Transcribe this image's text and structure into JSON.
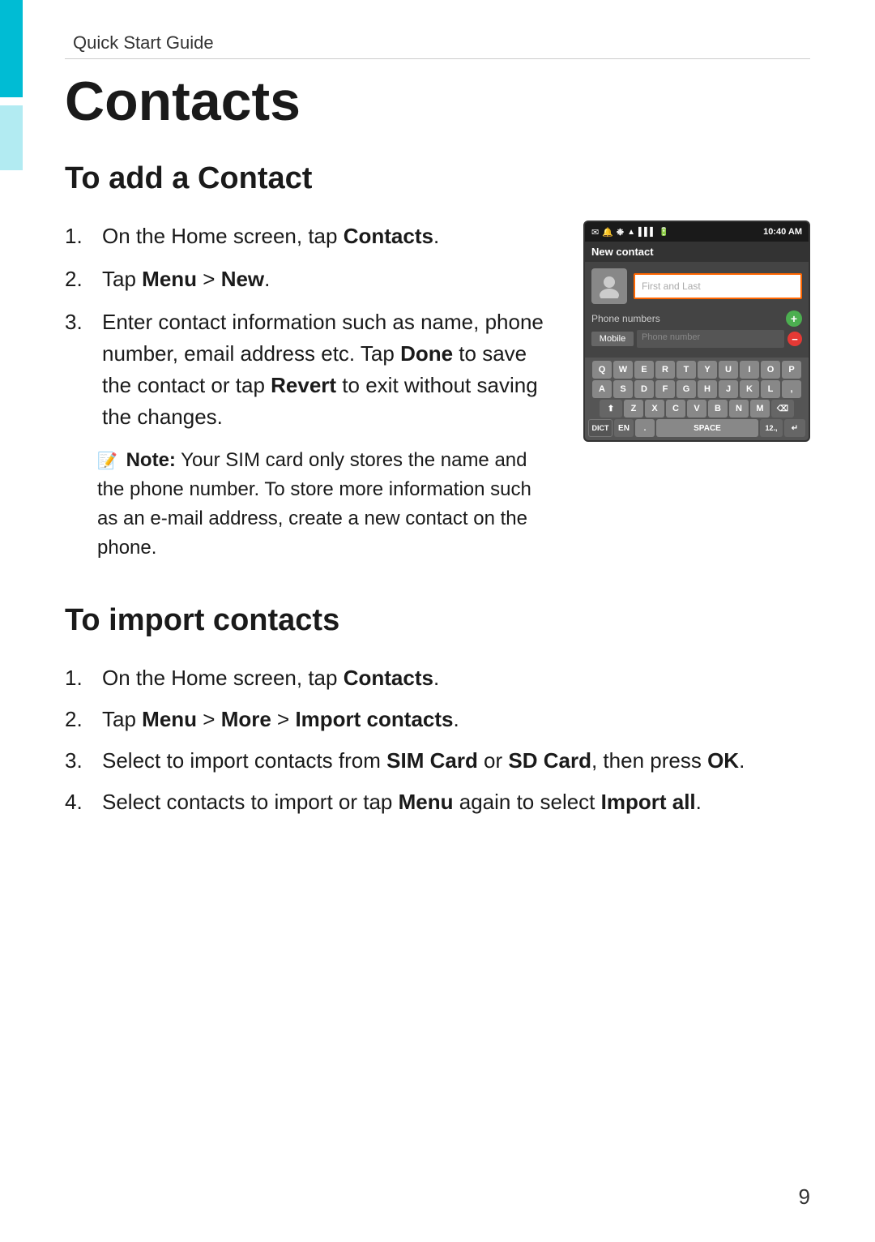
{
  "page": {
    "quick_start_label": "Quick Start Guide",
    "title": "Contacts",
    "page_number": "9"
  },
  "add_contact": {
    "heading": "To add a Contact",
    "steps": [
      {
        "num": "1.",
        "text_parts": [
          {
            "type": "normal",
            "text": "On the Home screen, tap "
          },
          {
            "type": "bold",
            "text": "Contacts"
          },
          {
            "type": "normal",
            "text": "."
          }
        ]
      },
      {
        "num": "2.",
        "text_parts": [
          {
            "type": "normal",
            "text": "Tap "
          },
          {
            "type": "bold",
            "text": "Menu"
          },
          {
            "type": "normal",
            "text": " > "
          },
          {
            "type": "bold",
            "text": "New"
          },
          {
            "type": "normal",
            "text": "."
          }
        ]
      },
      {
        "num": "3.",
        "text_parts": [
          {
            "type": "normal",
            "text": "Enter contact information such as name, phone number, email address etc. Tap "
          },
          {
            "type": "bold",
            "text": "Done"
          },
          {
            "type": "normal",
            "text": " to save the contact or tap "
          },
          {
            "type": "bold",
            "text": "Revert"
          },
          {
            "type": "normal",
            "text": " to exit without saving the changes."
          }
        ]
      }
    ],
    "note": {
      "prefix": "Note:",
      "text": " Your SIM card only stores the name and the phone number. To store more information such as an e-mail address, create a new contact on the phone."
    }
  },
  "phone_screenshot": {
    "status_bar": {
      "time": "10:40 AM",
      "icons": [
        "bt",
        "wifi",
        "bars",
        "battery"
      ]
    },
    "app_bar_label": "New contact",
    "name_placeholder": "First and Last",
    "phone_numbers_label": "Phone numbers",
    "phone_type": "Mobile",
    "phone_placeholder": "Phone number",
    "keyboard_rows": [
      [
        "Q",
        "W",
        "E",
        "R",
        "T",
        "Y",
        "U",
        "I",
        "O",
        "P"
      ],
      [
        "A",
        "S",
        "D",
        "F",
        "G",
        "H",
        "J",
        "K",
        "L",
        ","
      ],
      [
        "Z",
        "X",
        "C",
        "V",
        "B",
        "N",
        "M"
      ]
    ],
    "bottom_keys": [
      "DICT",
      "EN",
      ".",
      "SPACE",
      "12.,",
      "↵"
    ]
  },
  "import_contacts": {
    "heading": "To import contacts",
    "steps": [
      {
        "num": "1.",
        "text_parts": [
          {
            "type": "normal",
            "text": "On the Home screen, tap "
          },
          {
            "type": "bold",
            "text": "Contacts"
          },
          {
            "type": "normal",
            "text": "."
          }
        ]
      },
      {
        "num": "2.",
        "text_parts": [
          {
            "type": "normal",
            "text": "Tap "
          },
          {
            "type": "bold",
            "text": "Menu"
          },
          {
            "type": "normal",
            "text": " > "
          },
          {
            "type": "bold",
            "text": "More"
          },
          {
            "type": "normal",
            "text": " > "
          },
          {
            "type": "bold",
            "text": "Import contacts"
          },
          {
            "type": "normal",
            "text": "."
          }
        ]
      },
      {
        "num": "3.",
        "text_parts": [
          {
            "type": "normal",
            "text": "Select to import contacts from "
          },
          {
            "type": "bold",
            "text": "SIM Card"
          },
          {
            "type": "normal",
            "text": " or "
          },
          {
            "type": "bold",
            "text": "SD Card"
          },
          {
            "type": "normal",
            "text": ", then press "
          },
          {
            "type": "bold",
            "text": "OK"
          },
          {
            "type": "normal",
            "text": "."
          }
        ]
      },
      {
        "num": "4.",
        "text_parts": [
          {
            "type": "normal",
            "text": "Select contacts to import or tap "
          },
          {
            "type": "bold",
            "text": "Menu"
          },
          {
            "type": "normal",
            "text": " again to select "
          },
          {
            "type": "bold",
            "text": "Import all"
          },
          {
            "type": "normal",
            "text": "."
          }
        ]
      }
    ]
  }
}
